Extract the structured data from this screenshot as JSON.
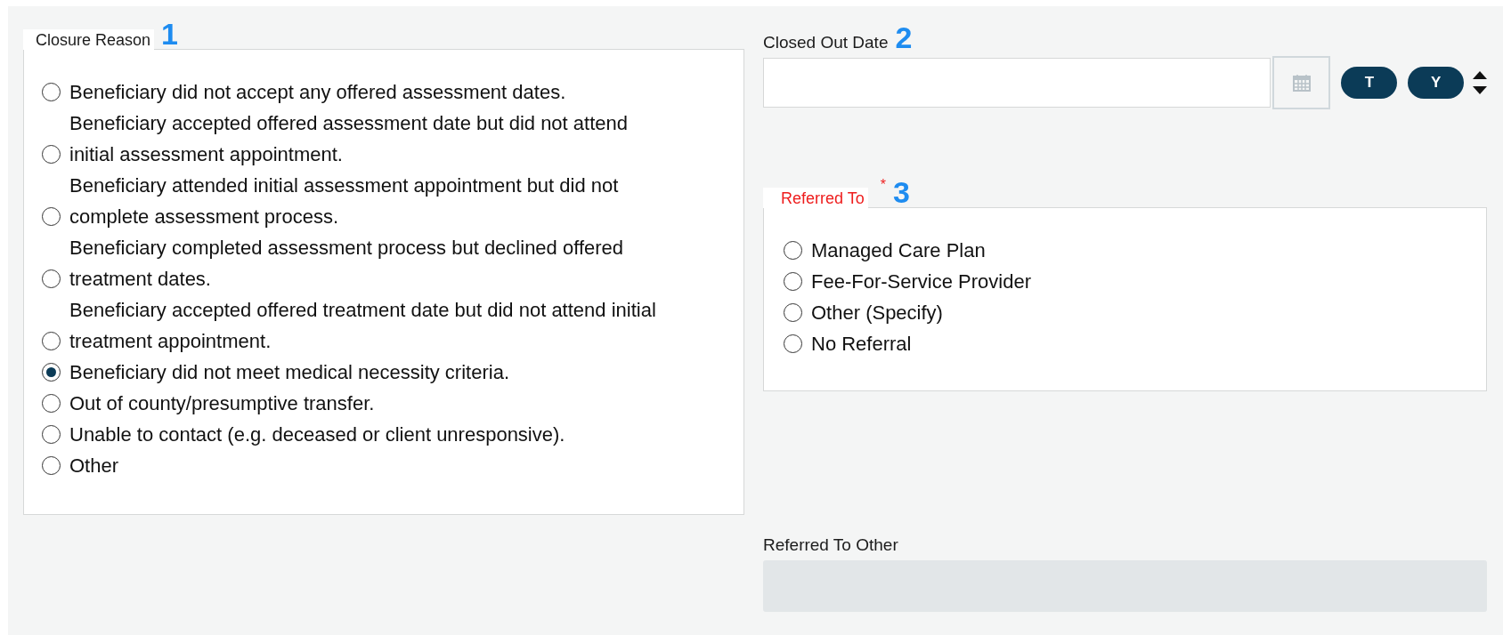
{
  "closure_reason": {
    "legend": "Closure Reason",
    "marker": "1",
    "options": [
      {
        "lines": [
          "Beneficiary did not accept any offered assessment dates."
        ],
        "selected": false
      },
      {
        "lines": [
          "Beneficiary accepted offered assessment date but did not attend",
          "initial assessment appointment."
        ],
        "selected": false
      },
      {
        "lines": [
          "Beneficiary attended initial assessment appointment but did not",
          "complete assessment process."
        ],
        "selected": false
      },
      {
        "lines": [
          "Beneficiary completed assessment process but declined offered",
          "treatment dates."
        ],
        "selected": false
      },
      {
        "lines": [
          "Beneficiary accepted offered treatment date but did not attend initial",
          "treatment appointment."
        ],
        "selected": false
      },
      {
        "lines": [
          "Beneficiary did not meet medical necessity criteria."
        ],
        "selected": true
      },
      {
        "lines": [
          "Out of county/presumptive transfer."
        ],
        "selected": false
      },
      {
        "lines": [
          "Unable to contact (e.g. deceased or client unresponsive)."
        ],
        "selected": false
      },
      {
        "lines": [
          "Other"
        ],
        "selected": false
      }
    ]
  },
  "closed_out_date": {
    "label": "Closed Out Date",
    "marker": "2",
    "buttons": [
      "T",
      "Y"
    ]
  },
  "referred_to": {
    "legend": "Referred To",
    "required": true,
    "required_mark": "*",
    "marker": "3",
    "options": [
      {
        "lines": [
          "Managed Care Plan"
        ],
        "selected": false
      },
      {
        "lines": [
          "Fee-For-Service Provider"
        ],
        "selected": false
      },
      {
        "lines": [
          "Other (Specify)"
        ],
        "selected": false
      },
      {
        "lines": [
          "No Referral"
        ],
        "selected": false
      }
    ]
  },
  "referred_to_other": {
    "label": "Referred To Other",
    "disabled": true
  }
}
